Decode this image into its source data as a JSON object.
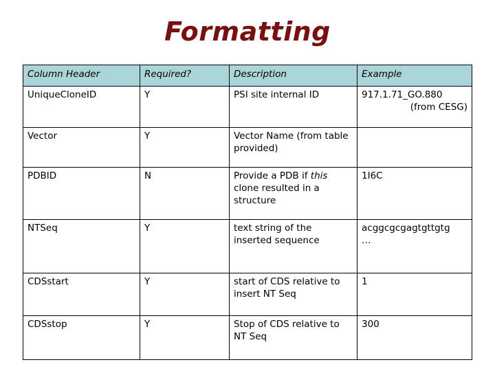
{
  "slide": {
    "title": "Formatting",
    "title_color": "#7b0f0f",
    "header_fill": "#a9d5d8"
  },
  "table": {
    "headers": [
      "Column Header",
      "Required?",
      "Description",
      "Example"
    ],
    "rows": [
      {
        "name": "UniqueCloneID",
        "required": "Y",
        "description": "PSI site internal ID",
        "description_lines": [
          "PSI site internal ID"
        ],
        "example": "917.1.71_GO.880 (from CESG)",
        "example_line1": "917.1.71_GO.880",
        "example_line2": "(from CESG)"
      },
      {
        "name": "Vector",
        "required": "Y",
        "description": "Vector Name (from table provided)",
        "description_lines": [
          "Vector Name (from",
          "table provided)"
        ],
        "example": ""
      },
      {
        "name": "PDBID",
        "required": "N",
        "description": "Provide a PDB if this clone resulted in a structure",
        "description_pre": "Provide a PDB if ",
        "description_em": "this",
        "description_post": " clone resulted in a structure",
        "example": "1I6C"
      },
      {
        "name": "NTSeq",
        "required": "Y",
        "description": "text string of the inserted sequence",
        "description_lines": [
          "text string of the",
          "inserted",
          "sequence"
        ],
        "example": "acggcgcgagtgttgtg",
        "example_line1": "acggcgcgagtgttgtg",
        "example_line2": "…"
      },
      {
        "name": "CDSstart",
        "required": "Y",
        "description": "start of CDS relative to insert NT Seq",
        "description_lines": [
          "start of CDS relative",
          "to insert NT Seq"
        ],
        "example": "1"
      },
      {
        "name": "CDSstop",
        "required": "Y",
        "description": "Stop of CDS relative to NT Seq",
        "description_lines": [
          "Stop of CDS relative",
          "to NT Seq"
        ],
        "example": "300"
      }
    ]
  }
}
